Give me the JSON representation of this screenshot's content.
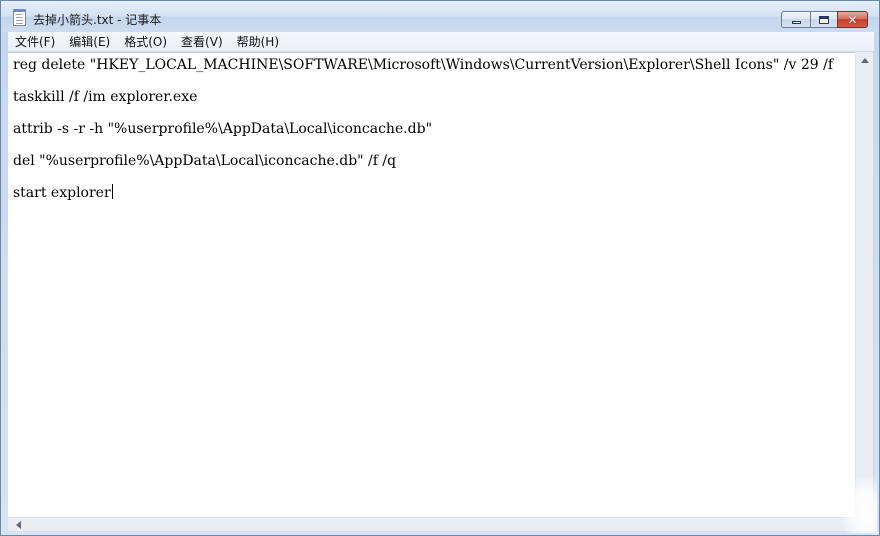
{
  "window": {
    "title": "去掉小箭头.txt - 记事本"
  },
  "menubar": {
    "items": [
      {
        "label": "文件(F)"
      },
      {
        "label": "编辑(E)"
      },
      {
        "label": "格式(O)"
      },
      {
        "label": "查看(V)"
      },
      {
        "label": "帮助(H)"
      }
    ]
  },
  "editor": {
    "lines": [
      "reg delete \"HKEY_LOCAL_MACHINE\\SOFTWARE\\Microsoft\\Windows\\CurrentVersion\\Explorer\\Shell Icons\" /v 29 /f",
      "taskkill /f /im explorer.exe",
      "attrib -s -r -h \"%userprofile%\\AppData\\Local\\iconcache.db\"",
      "del \"%userprofile%\\AppData\\Local\\iconcache.db\" /f /q",
      "start explorer"
    ]
  },
  "icons": {
    "app": "notepad-icon",
    "minimize": "minimize-icon",
    "maximize": "maximize-icon",
    "close": "close-icon"
  },
  "colors": {
    "close_button": "#c4402b",
    "frame": "#c9dcf2"
  }
}
